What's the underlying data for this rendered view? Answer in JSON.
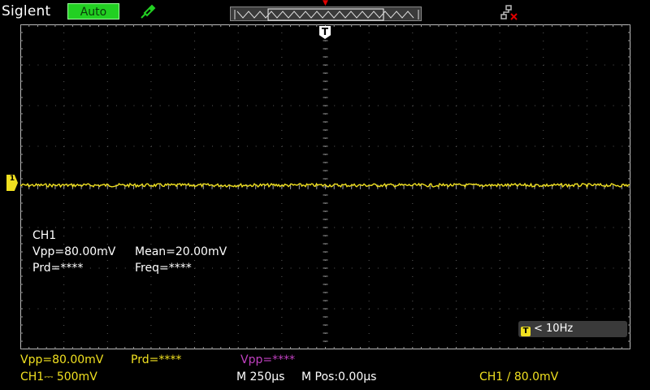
{
  "top_bar": {
    "brand": "Siglent",
    "mode": "Auto",
    "probe_icon": "probe-icon",
    "network_icon": "network-disconnected-icon"
  },
  "markers": {
    "trigger_marker": "T",
    "ch1_marker": "1"
  },
  "measurements": {
    "channel": "CH1",
    "vpp": "Vpp=80.00mV",
    "mean": "Mean=20.00mV",
    "prd": "Prd=****",
    "freq": "Freq=****"
  },
  "trigger_frequency": "< 10Hz",
  "status": {
    "vpp": "Vpp=80.00mV",
    "prd": "Prd=****",
    "vpp_ch2": "Vpp=****",
    "ch1_scale": "CH1⎓ 500mV",
    "timebase": "M 250µs",
    "mpos": "M Pos:0.00µs",
    "trigger": "CH1 ∕ 80.0mV"
  },
  "colors": {
    "ch1": "#f0e020",
    "ch2": "#c040c0",
    "mode_bg": "#22d022",
    "grid": "#5a5a5a"
  }
}
